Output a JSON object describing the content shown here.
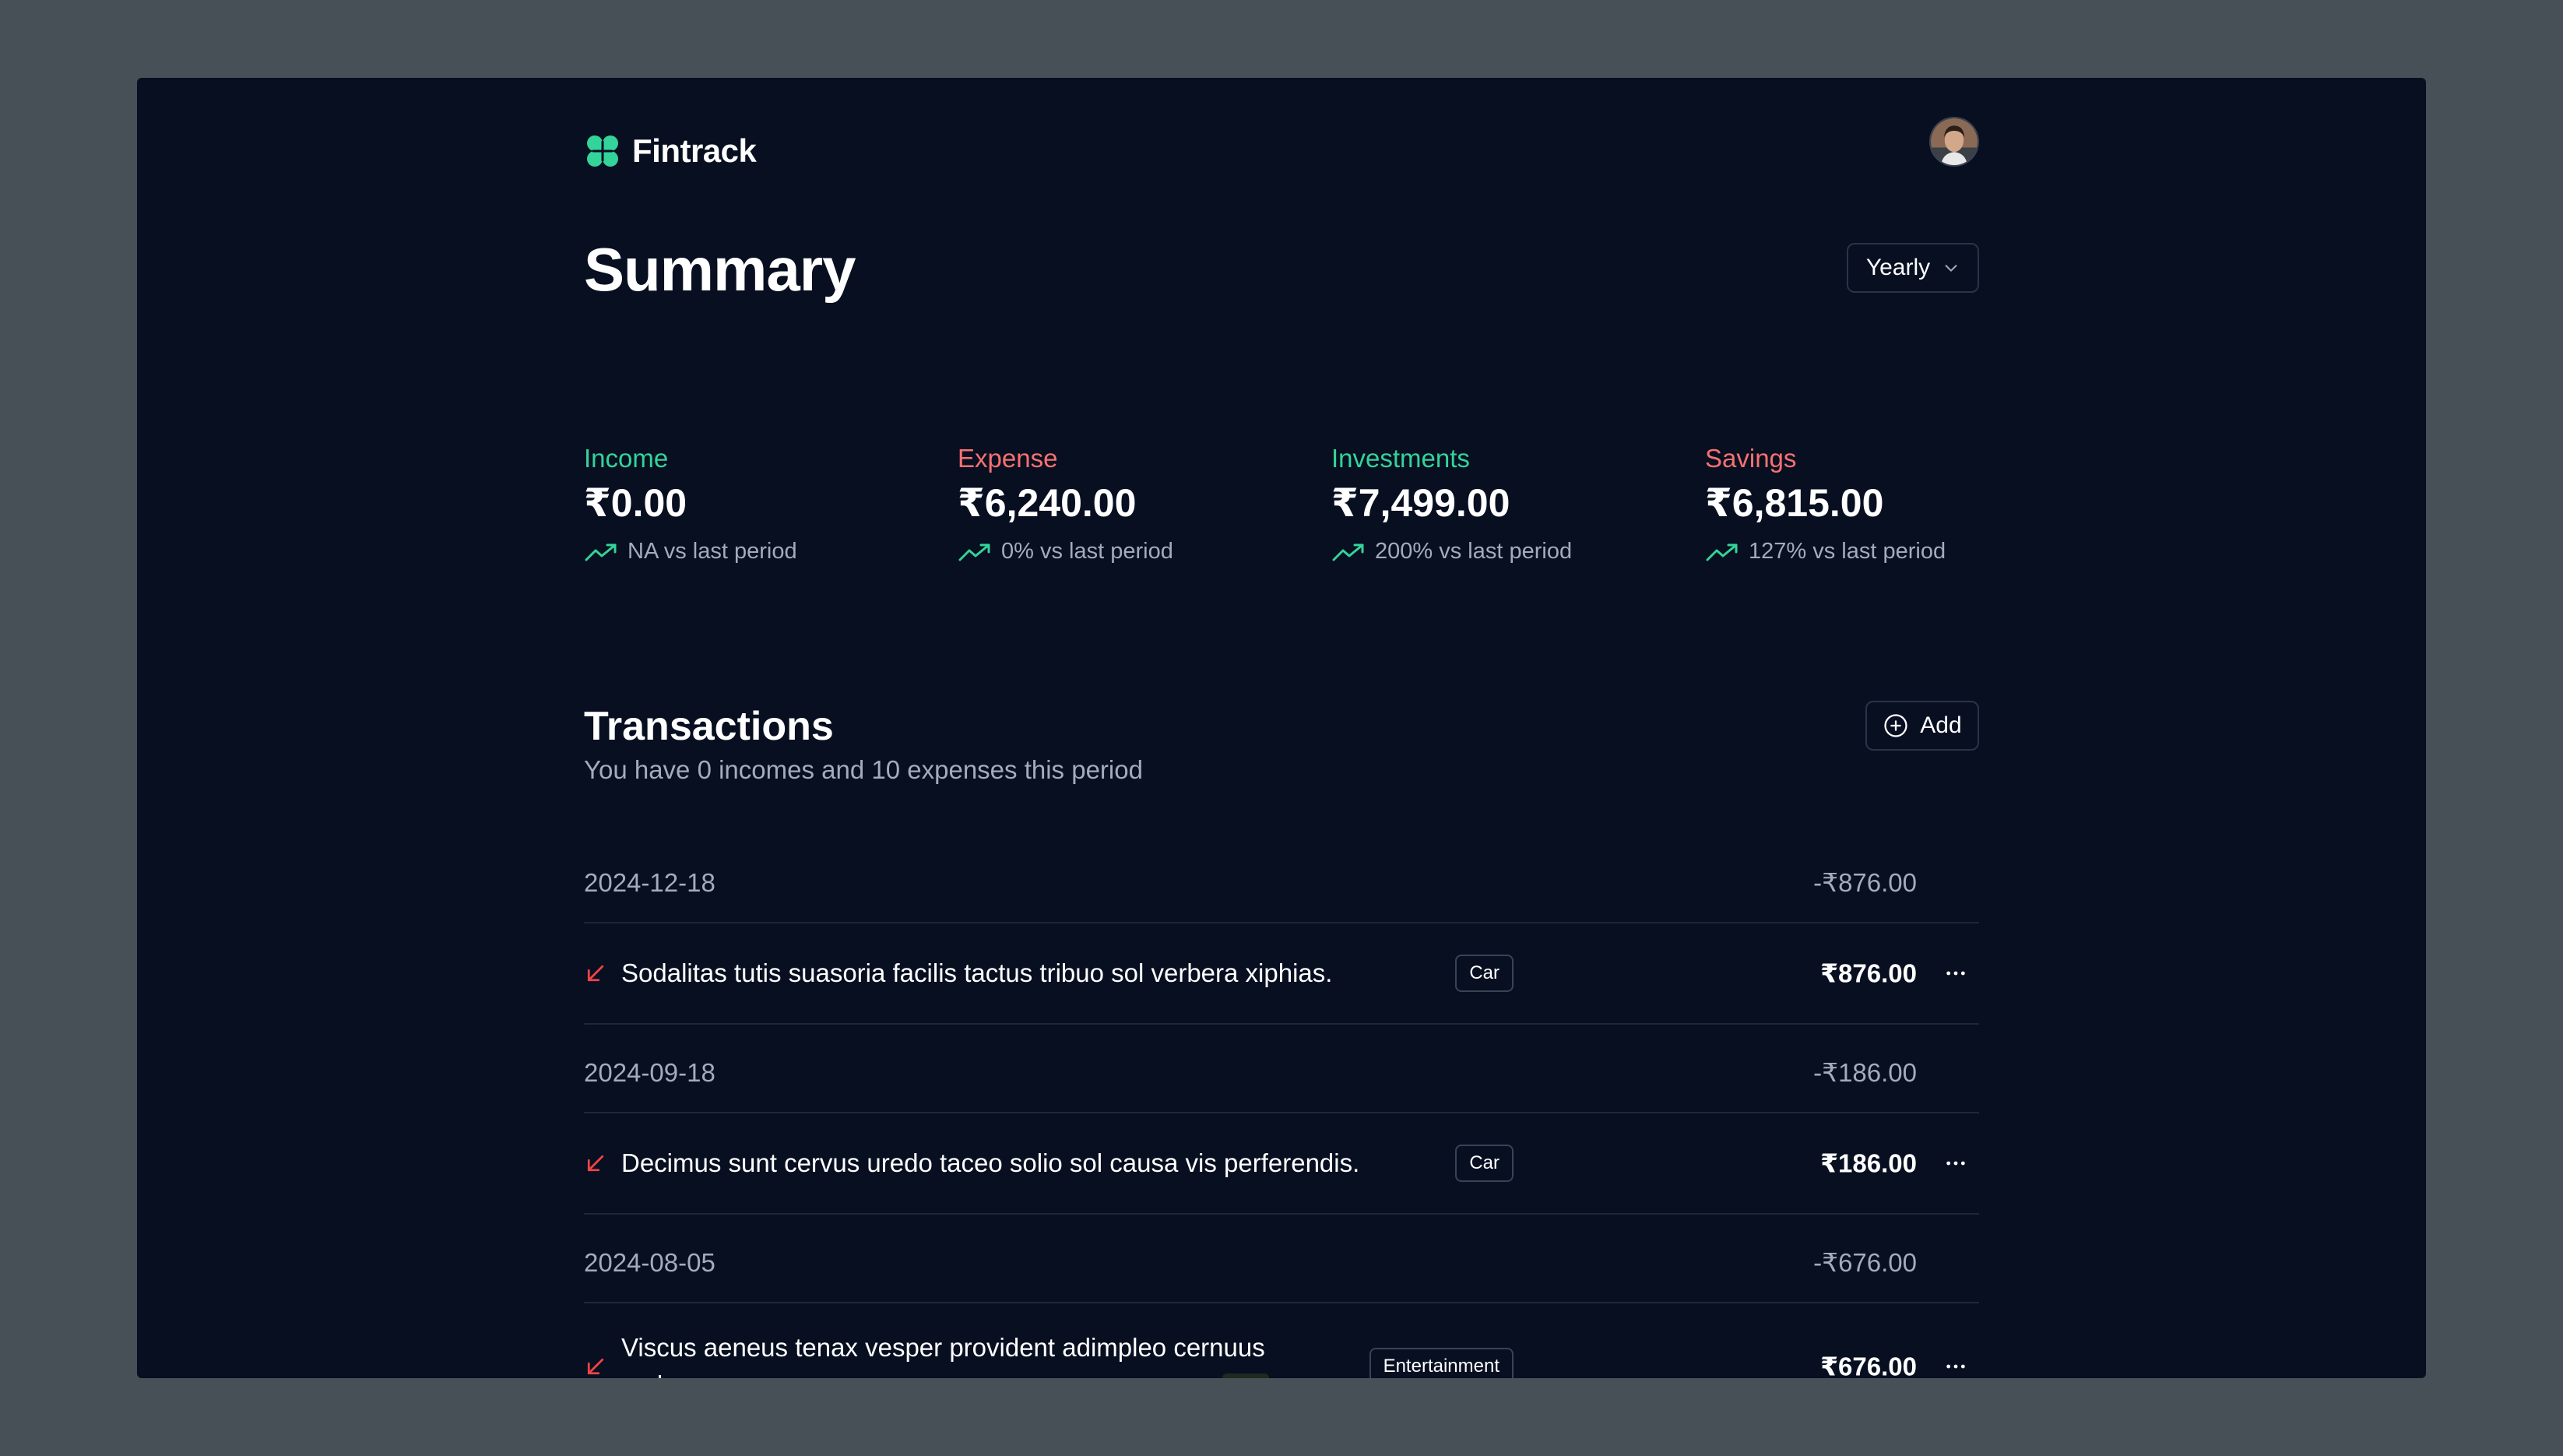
{
  "app": {
    "name": "Fintrack",
    "brand_color": "#34d399"
  },
  "header": {
    "logo_icon": "clover-logo-icon",
    "avatar_icon": "user-avatar"
  },
  "summary": {
    "title": "Summary",
    "period": {
      "selected": "Yearly",
      "icon": "chevron-down-icon"
    },
    "stats": [
      {
        "label": "Income",
        "value": "₹0.00",
        "trend": "NA vs last period",
        "label_color": "#34d399"
      },
      {
        "label": "Expense",
        "value": "₹6,240.00",
        "trend": "0% vs last period",
        "label_color": "#f87171"
      },
      {
        "label": "Investments",
        "value": "₹7,499.00",
        "trend": "200% vs last period",
        "label_color": "#34d399"
      },
      {
        "label": "Savings",
        "value": "₹6,815.00",
        "trend": "127% vs last period",
        "label_color": "#f87171"
      }
    ],
    "trend_icon": "trending-up-icon",
    "trend_color": "#34d399"
  },
  "transactions": {
    "title": "Transactions",
    "subtitle": "You have 0 incomes and 10 expenses this period",
    "add_label": "Add",
    "groups": [
      {
        "date": "2024-12-18",
        "total": "-₹876.00",
        "items": [
          {
            "description": "Sodalitas tutis suasoria facilis tactus tribuo sol verbera xiphias.",
            "category": "Car",
            "amount": "₹876.00",
            "type": "expense"
          }
        ]
      },
      {
        "date": "2024-09-18",
        "total": "-₹186.00",
        "items": [
          {
            "description": "Decimus sunt cervus uredo taceo solio sol causa vis perferendis.",
            "category": "Car",
            "amount": "₹186.00",
            "type": "expense"
          }
        ]
      },
      {
        "date": "2024-08-05",
        "total": "-₹676.00",
        "items": [
          {
            "description": "Viscus aeneus tenax vesper provident adimpleo cernuus creber.",
            "category": "Entertainment",
            "amount": "₹676.00",
            "type": "expense"
          }
        ]
      }
    ],
    "expense_icon": "arrow-down-left-icon",
    "expense_color": "#ef4444",
    "more_icon": "more-horizontal-icon"
  }
}
